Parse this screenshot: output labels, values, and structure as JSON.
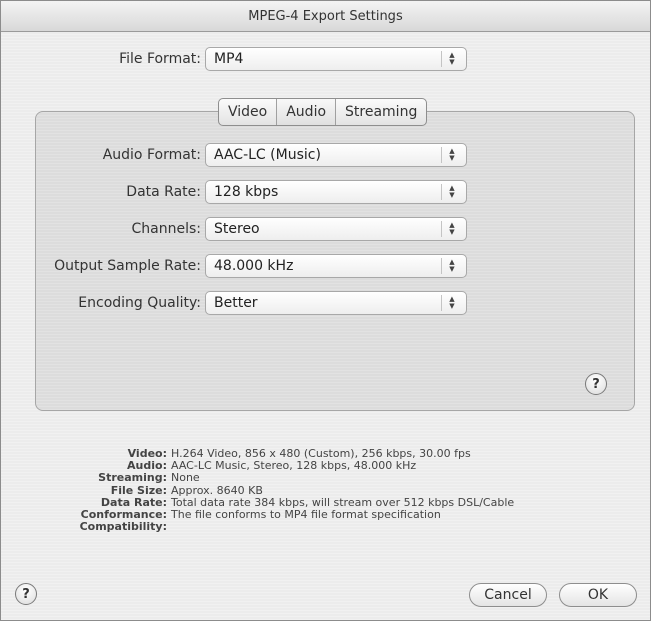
{
  "window": {
    "title": "MPEG-4 Export Settings"
  },
  "file_format": {
    "label": "File Format:",
    "value": "MP4"
  },
  "tabs": [
    {
      "label": "Video"
    },
    {
      "label": "Audio",
      "selected": true
    },
    {
      "label": "Streaming"
    }
  ],
  "audio_settings": [
    {
      "label": "Audio Format:",
      "value": "AAC-LC (Music)"
    },
    {
      "label": "Data Rate:",
      "value": "128 kbps"
    },
    {
      "label": "Channels:",
      "value": "Stereo"
    },
    {
      "label": "Output Sample Rate:",
      "value": "48.000 kHz"
    },
    {
      "label": "Encoding Quality:",
      "value": "Better"
    }
  ],
  "help_symbol": "?",
  "summary": [
    {
      "key": "Video:",
      "value": "H.264 Video, 856 x 480 (Custom), 256 kbps, 30.00 fps"
    },
    {
      "key": "Audio:",
      "value": "AAC-LC Music, Stereo, 128 kbps, 48.000 kHz"
    },
    {
      "key": "Streaming:",
      "value": "None"
    },
    {
      "key": "File Size:",
      "value": "Approx. 8640 KB"
    },
    {
      "key": "Data Rate:",
      "value": "Total data rate 384 kbps, will stream over 512 kbps DSL/Cable"
    },
    {
      "key": "Conformance:",
      "value": "The file conforms to MP4 file format specification"
    },
    {
      "key": "Compatibility:",
      "value": ""
    }
  ],
  "buttons": {
    "cancel": "Cancel",
    "ok": "OK"
  },
  "icons": {
    "stepper_up": "▲",
    "stepper_down": "▼"
  }
}
